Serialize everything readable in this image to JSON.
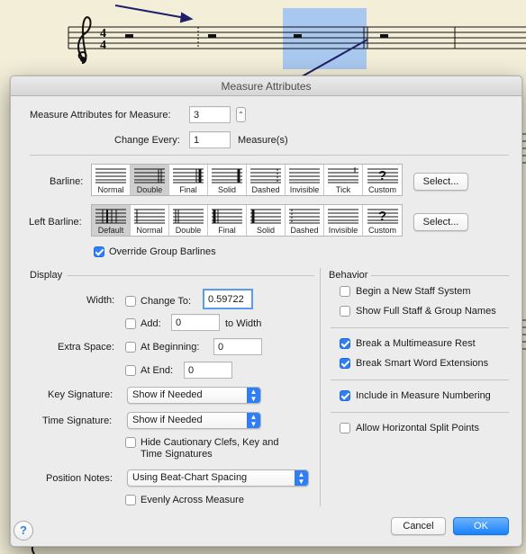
{
  "colors": {
    "accent": "#2f7ef3",
    "paper": "#f3eed8",
    "selection": "#a9c8ef"
  },
  "dialog": {
    "title": "Measure Attributes",
    "measure_label": "Measure Attributes for Measure:",
    "measure_value": "3",
    "change_every_label": "Change Every:",
    "change_every_value": "1",
    "change_every_unit": "Measure(s)"
  },
  "barline": {
    "label": "Barline:",
    "options": [
      "Normal",
      "Double",
      "Final",
      "Solid",
      "Dashed",
      "Invisible",
      "Tick",
      "Custom"
    ],
    "selected": "Double",
    "select_button": "Select..."
  },
  "left_barline": {
    "label": "Left Barline:",
    "options": [
      "Default",
      "Normal",
      "Double",
      "Final",
      "Solid",
      "Dashed",
      "Invisible",
      "Custom"
    ],
    "selected": "Default",
    "select_button": "Select..."
  },
  "override_group": {
    "label": "Override Group Barlines",
    "checked": true
  },
  "display": {
    "title": "Display",
    "width_label": "Width:",
    "change_to_label": "Change To:",
    "change_to_value": "0.59722",
    "add_label": "Add:",
    "add_value": "0",
    "to_width_label": "to Width",
    "extra_space_label": "Extra Space:",
    "at_beginning_label": "At Beginning:",
    "at_beginning_value": "0",
    "at_end_label": "At End:",
    "at_end_value": "0",
    "key_sig_label": "Key Signature:",
    "key_sig_value": "Show if Needed",
    "time_sig_label": "Time Signature:",
    "time_sig_value": "Show if Needed",
    "hide_cautionary_line1": "Hide Cautionary Clefs, Key and",
    "hide_cautionary_line2": "Time Signatures",
    "position_notes_label": "Position Notes:",
    "position_notes_value": "Using Beat-Chart Spacing",
    "evenly_label": "Evenly Across Measure"
  },
  "behavior": {
    "title": "Behavior",
    "new_staff_system": "Begin a New Staff System",
    "full_staff_names": "Show Full Staff & Group Names",
    "break_multimeasure": "Break a Multimeasure Rest",
    "break_smart_word": "Break Smart Word Extensions",
    "include_numbering": "Include in Measure Numbering",
    "allow_split": "Allow Horizontal Split Points",
    "checked": {
      "new_staff_system": false,
      "full_staff_names": false,
      "break_multimeasure": true,
      "break_smart_word": true,
      "include_numbering": true,
      "allow_split": false
    }
  },
  "footer": {
    "help": "?",
    "cancel": "Cancel",
    "ok": "OK"
  },
  "score": {
    "time_sig_top": "4",
    "time_sig_bottom": "4"
  }
}
